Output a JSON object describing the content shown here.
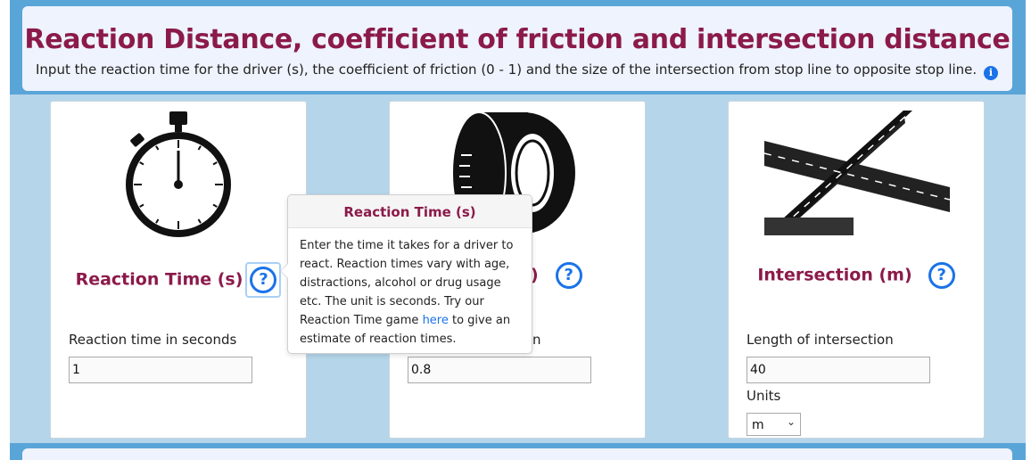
{
  "header": {
    "title": "Reaction Distance, coefficient of friction and intersection distance",
    "description": "Input the reaction time for the driver (s), the coefficient of friction (0 - 1) and the size of the intersection from stop line to opposite stop line.",
    "info_icon": "info-icon"
  },
  "cards": [
    {
      "icon": "stopwatch-icon",
      "title": "Reaction Time (s)",
      "help_glyph": "?",
      "field_label": "Reaction time in seconds",
      "field_value": "1"
    },
    {
      "icon": "tyre-icon",
      "title_visible": ")",
      "help_glyph": "?",
      "field_label_visible": "n",
      "field_value": "0.8"
    },
    {
      "icon": "intersection-icon",
      "title": "Intersection (m)",
      "help_glyph": "?",
      "field_label": "Length of intersection",
      "field_value": "40",
      "units_label": "Units",
      "units_selected": "m"
    }
  ],
  "popover": {
    "title": "Reaction Time (s)",
    "body_before_link": "Enter the time it takes for a driver to react. Reaction times vary with age, distractions, alcohol or drug usage etc. The unit is seconds. Try our Reaction Time game ",
    "link_text": "here",
    "body_after_link": " to give an estimate of reaction times."
  },
  "colors": {
    "accent": "#8b1a4a",
    "link": "#1a73e8",
    "frame": "#5aa5d8",
    "background": "#b5d5ea"
  }
}
